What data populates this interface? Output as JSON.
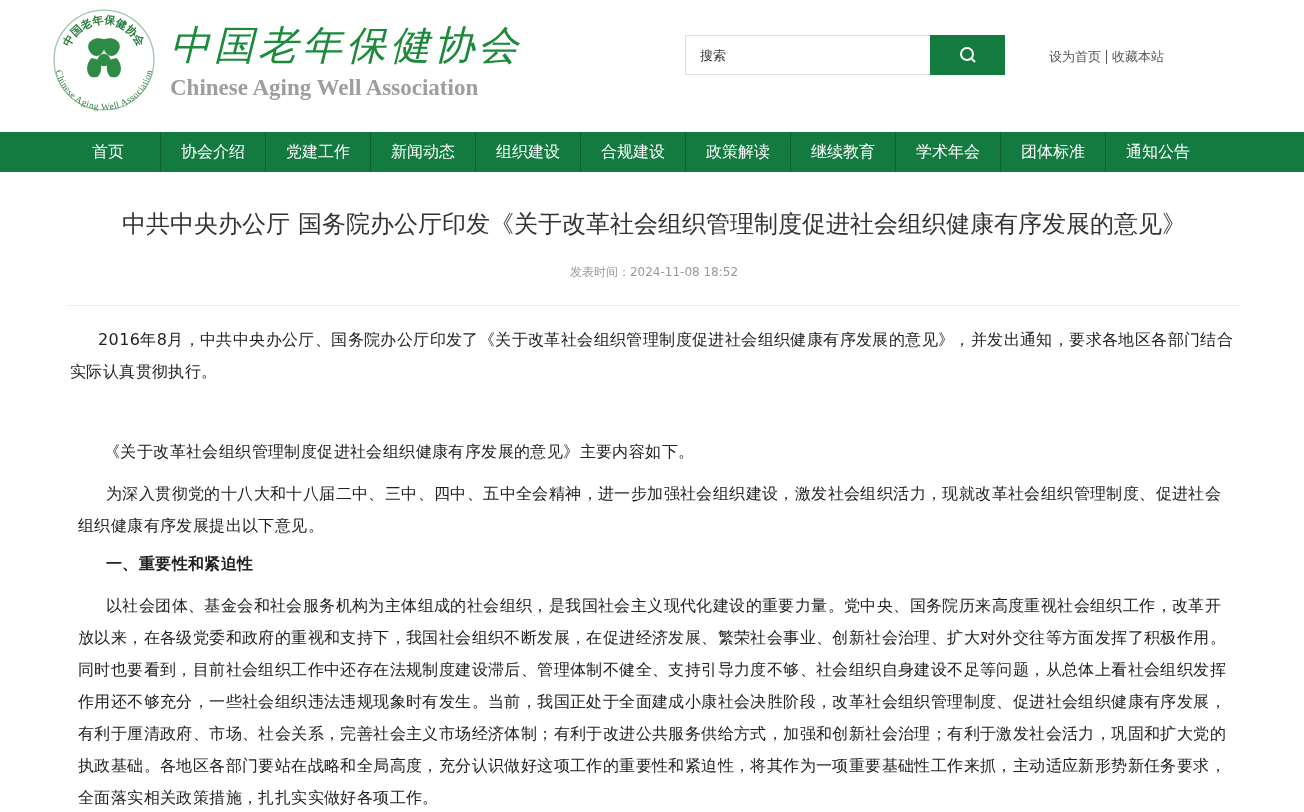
{
  "logo": {
    "emblem_top": "中国老年保健协会",
    "emblem_bottom": "Chinese Aging Well Association",
    "name_cn": "中国老年保健协会",
    "name_en": "Chinese Aging Well Association"
  },
  "search": {
    "placeholder": "搜索"
  },
  "top_links": [
    "设为首页",
    "收藏本站"
  ],
  "nav": [
    {
      "label": "首页"
    },
    {
      "label": "协会介绍"
    },
    {
      "label": "党建工作"
    },
    {
      "label": "新闻动态"
    },
    {
      "label": "组织建设"
    },
    {
      "label": "合规建设"
    },
    {
      "label": "政策解读"
    },
    {
      "label": "继续教育"
    },
    {
      "label": "学术年会"
    },
    {
      "label": "团体标准"
    },
    {
      "label": "通知公告"
    }
  ],
  "article": {
    "title": "中共中央办公厅 国务院办公厅印发《关于改革社会组织管理制度促进社会组织健康有序发展的意见》",
    "published": "发表时间：2024-11-08 18:52",
    "paragraphs": [
      {
        "kind": "intro",
        "text": "2016年8月，中共中央办公厅、国务院办公厅印发了《关于改革社会组织管理制度促进社会组织健康有序发展的意见》，并发出通知，要求各地区各部门结合实际认真贯彻执行。"
      },
      {
        "kind": "lead",
        "text": "《关于改革社会组织管理制度促进社会组织健康有序发展的意见》主要内容如下。"
      },
      {
        "kind": "body",
        "text": "为深入贯彻党的十八大和十八届二中、三中、四中、五中全会精神，进一步加强社会组织建设，激发社会组织活力，现就改革社会组织管理制度、促进社会组织健康有序发展提出以下意见。"
      },
      {
        "kind": "heading",
        "text": "一、重要性和紧迫性"
      },
      {
        "kind": "body",
        "text": "以社会团体、基金会和社会服务机构为主体组成的社会组织，是我国社会主义现代化建设的重要力量。党中央、国务院历来高度重视社会组织工作，改革开放以来，在各级党委和政府的重视和支持下，我国社会组织不断发展，在促进经济发展、繁荣社会事业、创新社会治理、扩大对外交往等方面发挥了积极作用。同时也要看到，目前社会组织工作中还存在法规制度建设滞后、管理体制不健全、支持引导力度不够、社会组织自身建设不足等问题，从总体上看社会组织发挥作用还不够充分，一些社会组织违法违规现象时有发生。当前，我国正处于全面建成小康社会决胜阶段，改革社会组织管理制度、促进社会组织健康有序发展，有利于厘清政府、市场、社会关系，完善社会主义市场经济体制；有利于改进公共服务供给方式，加强和创新社会治理；有利于激发社会活力，巩固和扩大党的执政基础。各地区各部门要站在战略和全局高度，充分认识做好这项工作的重要性和紧迫性，将其作为一项重要基础性工作来抓，主动适应新形势新任务要求，全面落实相关政策措施，扎扎实实做好各项工作。"
      }
    ]
  }
}
